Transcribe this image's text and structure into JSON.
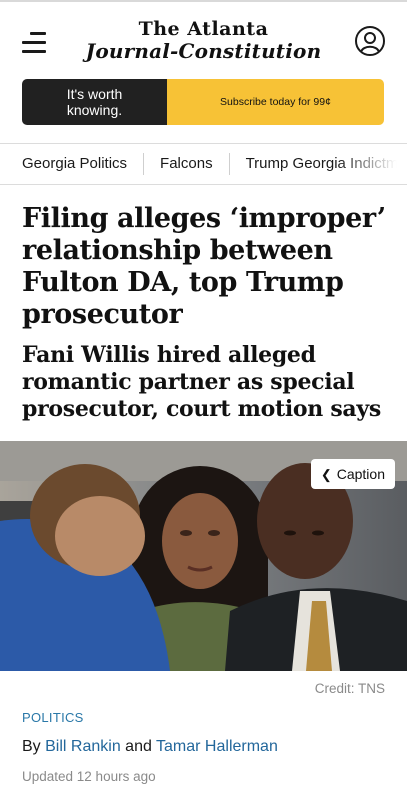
{
  "header": {
    "logo_line1": "The Atlanta",
    "logo_line2": "Journal-Constitution"
  },
  "promo": {
    "tagline": "It's worth knowing.",
    "cta": "Subscribe today for 99¢",
    "colors": {
      "dark": "#212121",
      "accent": "#f7c236"
    }
  },
  "nav": {
    "items": [
      {
        "label": "Georgia Politics"
      },
      {
        "label": "Falcons"
      },
      {
        "label": "Trump Georgia Indictment"
      }
    ]
  },
  "article": {
    "headline": "Filing alleges ‘improper’ relationship between Fulton DA, top Trump prosecutor",
    "subhead": "Fani Willis hired alleged romantic partner as special prosecutor, court motion says",
    "caption_button": "Caption",
    "credit": "Credit: TNS",
    "section": "POLITICS",
    "byline_prefix": "By",
    "author1": "Bill Rankin",
    "byline_and": "and",
    "author2": "Tamar Hallerman",
    "updated": "Updated 12 hours ago",
    "link_color": "#23679b"
  },
  "icons": {
    "menu": "hamburger-menu-icon",
    "account": "user-account-icon",
    "caption": "chevron-left-icon"
  }
}
